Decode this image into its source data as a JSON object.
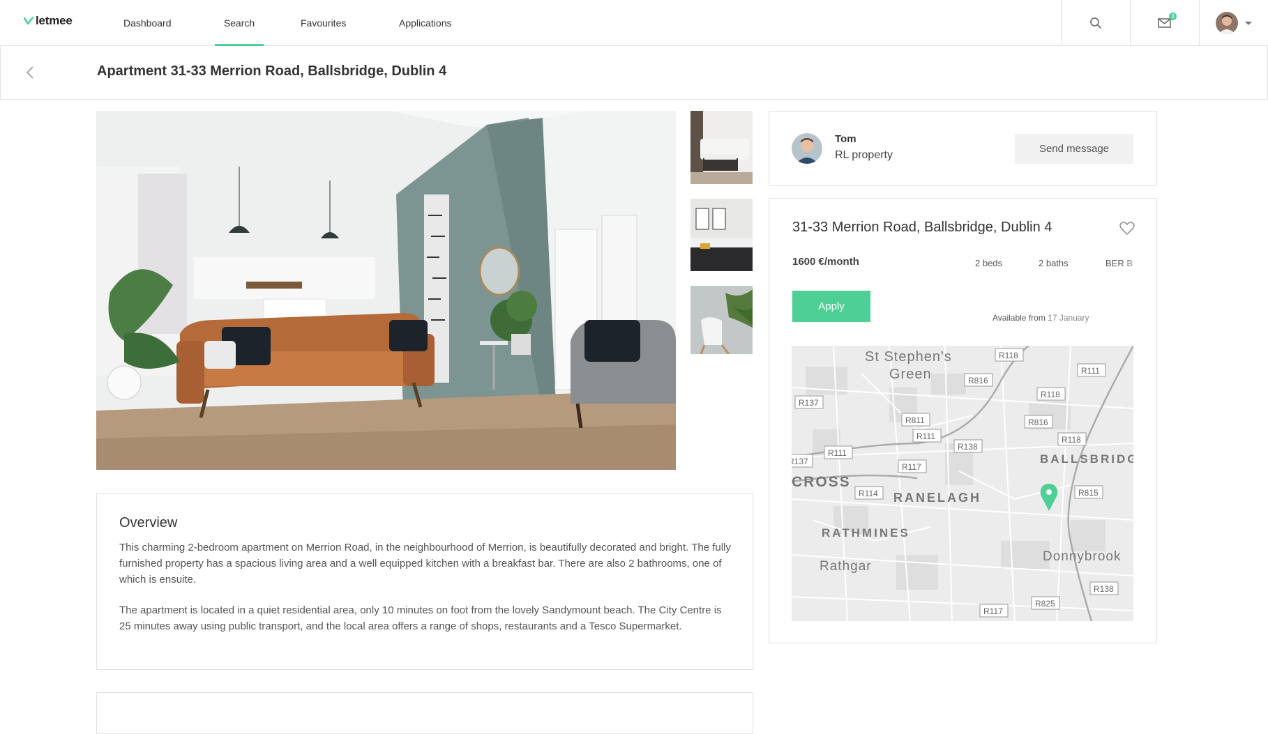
{
  "nav": {
    "logo": "letmee",
    "links": [
      "Dashboard",
      "Search",
      "Favourites",
      "Applications"
    ],
    "active": "Search",
    "mail_count": "3",
    "icons": [
      "search-icon",
      "mail-icon",
      "avatar",
      "chevron-down-icon"
    ]
  },
  "header": {
    "title": "Apartment 31-33 Merrion Road, Ballsbridge, Dublin 4"
  },
  "agent": {
    "name": "Tom",
    "company": "RL property",
    "send_label": "Send message"
  },
  "listing": {
    "address": "31-33 Merrion Road, Ballsbridge, Dublin 4",
    "price": "1600 €/month",
    "beds": "2 beds",
    "baths": "2 baths",
    "ber_label": "BER",
    "ber_value": "B",
    "apply_label": "Apply",
    "available_label": "Available from",
    "available_date": "17 January"
  },
  "map": {
    "labels": [
      "St Stephen's",
      "Green",
      "RANELAGH",
      "RATHMINES",
      "Rathgar",
      "Donnybrook",
      "BALLSBRIDG",
      "CROSS"
    ],
    "roads": [
      "R118",
      "R111",
      "R816",
      "R137",
      "R118",
      "R811",
      "R111",
      "R816",
      "R138",
      "R118",
      "R111",
      "R117",
      "R137",
      "R114",
      "R815",
      "R825",
      "R117",
      "R138"
    ]
  },
  "overview": {
    "title": "Overview",
    "p1": "This charming 2-bedroom apartment on Merrion Road, in the neighbourhood of Merrion, is beautifully decorated and bright. The fully furnished property has a spacious living area and a well equipped kitchen with a breakfast bar. There are also 2 bathrooms, one of which is ensuite.",
    "p2": "The apartment is located in a quiet residential area, only 10 minutes on foot from the lovely Sandymount beach. The City Centre is 25 minutes away using public transport, and the local area offers a range of shops, restaurants and a Tesco Supermarket."
  },
  "colors": {
    "accent": "#4ecf96",
    "border": "#e3e3e3"
  }
}
